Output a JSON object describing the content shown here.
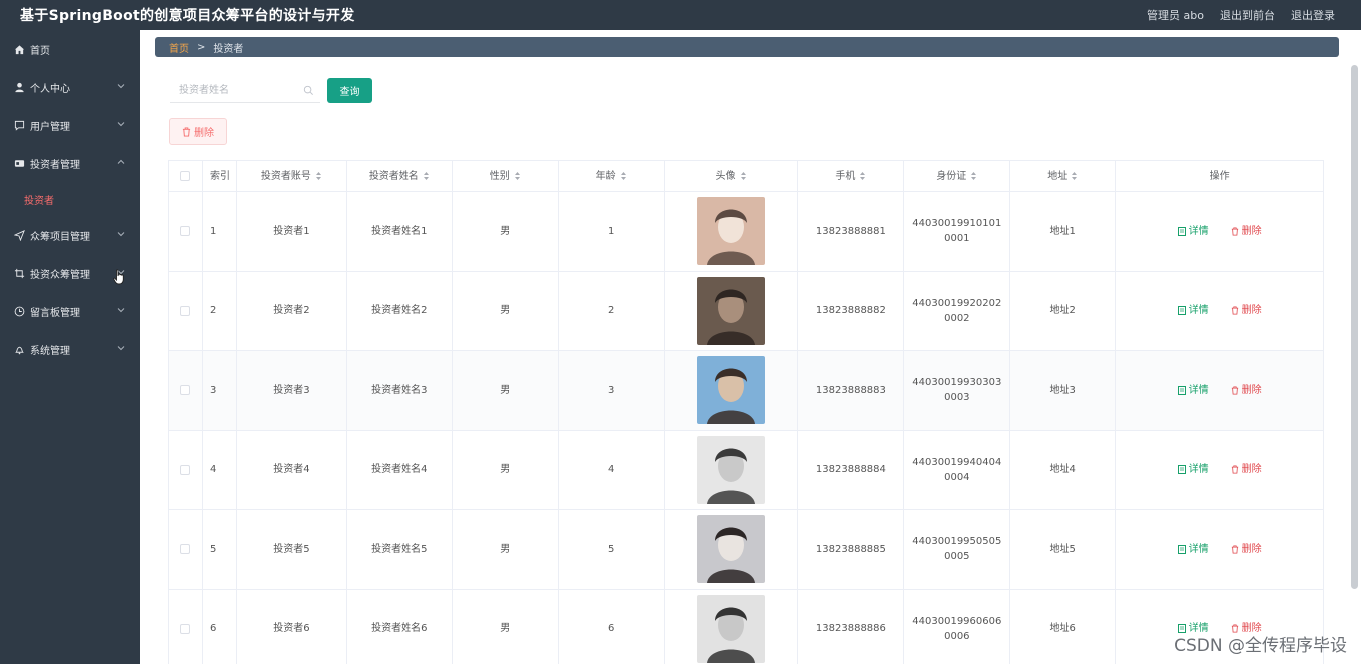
{
  "header": {
    "title": "基于SpringBoot的创意项目众筹平台的设计与开发",
    "user_label": "管理员 abo",
    "links": [
      "退出到前台",
      "退出登录"
    ]
  },
  "sidebar": {
    "items": [
      {
        "label": "首页",
        "icon": "home-icon"
      },
      {
        "label": "个人中心",
        "icon": "user-icon"
      },
      {
        "label": "用户管理",
        "icon": "chat-icon"
      },
      {
        "label": "投资者管理",
        "icon": "card-icon"
      },
      {
        "label": "众筹项目管理",
        "icon": "send-icon"
      },
      {
        "label": "投资众筹管理",
        "icon": "crop-icon"
      },
      {
        "label": "留言板管理",
        "icon": "clock-icon"
      },
      {
        "label": "系统管理",
        "icon": "bell-icon"
      }
    ],
    "active_sub": "投资者"
  },
  "breadcrumb": {
    "home": "首页",
    "sep": ">",
    "current": "投资者"
  },
  "search": {
    "placeholder": "投资者姓名",
    "button": "查询"
  },
  "actions": {
    "delete": "删除"
  },
  "table": {
    "headers": {
      "index": "索引",
      "account": "投资者账号",
      "name": "投资者姓名",
      "gender": "性别",
      "age": "年龄",
      "avatar": "头像",
      "phone": "手机",
      "idcard": "身份证",
      "address": "地址",
      "ops": "操作"
    },
    "op_detail": "详情",
    "op_delete": "删除",
    "rows": [
      {
        "index": "1",
        "account": "投资者1",
        "name": "投资者姓名1",
        "gender": "男",
        "age": "1",
        "phone": "13823888881",
        "idcard": "440300199101010001",
        "address": "地址1"
      },
      {
        "index": "2",
        "account": "投资者2",
        "name": "投资者姓名2",
        "gender": "男",
        "age": "2",
        "phone": "13823888882",
        "idcard": "440300199202020002",
        "address": "地址2"
      },
      {
        "index": "3",
        "account": "投资者3",
        "name": "投资者姓名3",
        "gender": "男",
        "age": "3",
        "phone": "13823888883",
        "idcard": "440300199303030003",
        "address": "地址3"
      },
      {
        "index": "4",
        "account": "投资者4",
        "name": "投资者姓名4",
        "gender": "男",
        "age": "4",
        "phone": "13823888884",
        "idcard": "440300199404040004",
        "address": "地址4"
      },
      {
        "index": "5",
        "account": "投资者5",
        "name": "投资者姓名5",
        "gender": "男",
        "age": "5",
        "phone": "13823888885",
        "idcard": "440300199505050005",
        "address": "地址5"
      },
      {
        "index": "6",
        "account": "投资者6",
        "name": "投资者姓名6",
        "gender": "男",
        "age": "6",
        "phone": "13823888886",
        "idcard": "440300199606060006",
        "address": "地址6"
      }
    ]
  },
  "watermark": "CSDN @全传程序毕设"
}
